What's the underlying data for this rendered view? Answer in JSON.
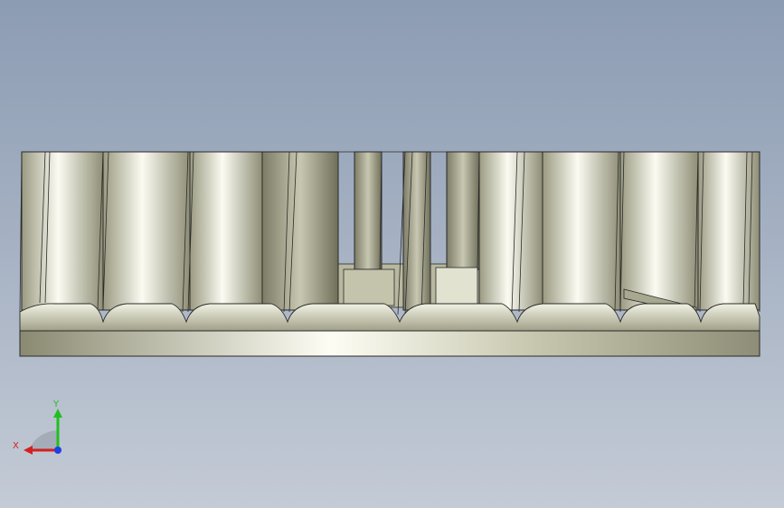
{
  "viewport": {
    "background_top": "#8c9cb3",
    "background_bottom": "#c4cbd6"
  },
  "model": {
    "body_color": "#d8d8c4",
    "highlight_color": "#f8f8ee",
    "shadow_color": "#8a8a72",
    "edge_color": "#2a2a2a"
  },
  "triad": {
    "x_label": "X",
    "y_label": "Y",
    "x_color": "#d42020",
    "y_color": "#20c020",
    "z_color": "#2040e0",
    "icon": "coordinate-triad-icon"
  }
}
